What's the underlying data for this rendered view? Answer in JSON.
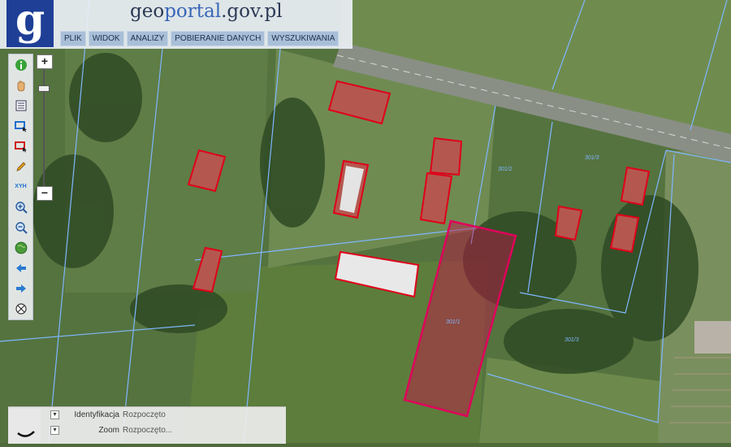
{
  "app": {
    "logo_glyph": "g",
    "title_prefix": "geo",
    "title_mid": "portal",
    "title_suffix": ".gov.pl"
  },
  "menu": [
    {
      "label": "PLIK"
    },
    {
      "label": "WIDOK"
    },
    {
      "label": "ANALIZY"
    },
    {
      "label": "POBIERANIE DANYCH"
    },
    {
      "label": "WYSZUKIWANIA"
    }
  ],
  "tools": [
    {
      "name": "info-icon"
    },
    {
      "name": "pan-hand-icon"
    },
    {
      "name": "legend-list-icon"
    },
    {
      "name": "select-blue-icon"
    },
    {
      "name": "select-red-icon"
    },
    {
      "name": "pencil-icon"
    },
    {
      "name": "xyh-icon",
      "label": "XYH"
    },
    {
      "name": "zoom-in-icon"
    },
    {
      "name": "zoom-out-icon"
    },
    {
      "name": "globe-icon"
    },
    {
      "name": "back-arrow-icon"
    },
    {
      "name": "forward-arrow-icon"
    },
    {
      "name": "crosshair-icon"
    }
  ],
  "zoom": {
    "plus": "+",
    "minus": "−"
  },
  "status": {
    "row1": {
      "label": "Identyfikacja",
      "value": "Rozpoczęto"
    },
    "row2": {
      "label": "Zoom",
      "value": "Rozpoczęto..."
    }
  },
  "parcels": {
    "label_a": "301/2",
    "label_b": "301/3",
    "label_c": "301/1",
    "label_d": "301/3"
  },
  "colors": {
    "brand_blue": "#1f3f96",
    "parcel_line": "#7fb6ff",
    "building_outline": "#e0001a",
    "selected_parcel": "#c8104a"
  }
}
